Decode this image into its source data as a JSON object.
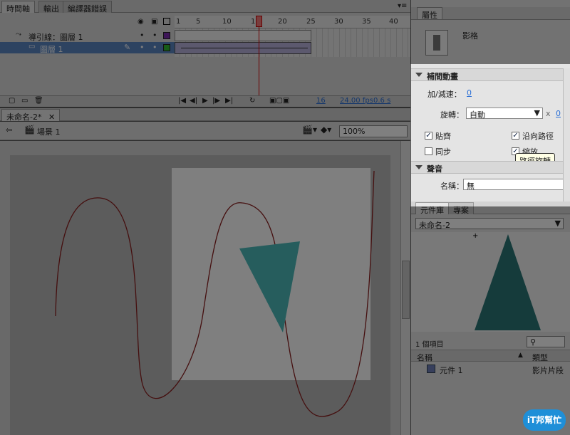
{
  "timeline_tabs": [
    "時間軸",
    "輸出",
    "編譯器錯誤"
  ],
  "layers": [
    {
      "name": "導引線：圖層 1"
    },
    {
      "name": "圖層 1"
    }
  ],
  "ruler_numbers": [
    "1",
    "5",
    "10",
    "15",
    "20",
    "25",
    "30",
    "35",
    "40"
  ],
  "playhead_frame": "15",
  "status": {
    "frame": "16",
    "fps": "24.00 fps",
    "time": "0.6 s"
  },
  "doc_tab": "未命名-2*",
  "scene": "場景 1",
  "zoom": "100%",
  "props": {
    "tab": "屬性",
    "type": "影格",
    "tween_section": "補間動畫",
    "ease_label": "加/減速：",
    "ease_value": "0",
    "rotate_label": "旋轉：",
    "rotate_value": "自動",
    "rotate_times": "0",
    "snap": "貼齊",
    "orient": "沿向路徑",
    "sync": "同步",
    "scale": "縮放",
    "tooltip": "路徑旋轉",
    "sound_section": "聲音",
    "name_label": "名稱：",
    "name_value": "無"
  },
  "library": {
    "tabs": [
      "元件庫",
      "專案"
    ],
    "doc": "未命名-2",
    "count": "1 個項目",
    "col_name": "名稱",
    "col_type": "類型",
    "item_name": "元件 1",
    "item_type": "影片片段"
  },
  "watermark": "iT邦幫忙",
  "colors": {
    "triangle": "#4dbbbb",
    "triangle_lib": "#2a7676",
    "guide": "#8a1e1e",
    "accent": "#2a6fd6"
  }
}
